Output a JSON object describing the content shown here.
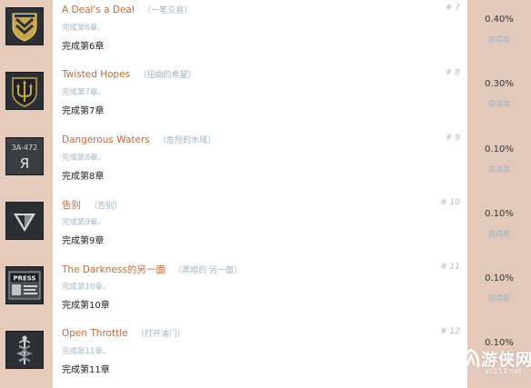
{
  "achievements": [
    {
      "title": "A Deal's a Deal",
      "subtitle": "（一笔交易）",
      "desc": "完成第6章。",
      "req": "完成第6章",
      "num": "# 7",
      "pct": "0.40%",
      "pct_label": "获得度",
      "icon": "chevron-shield-icon"
    },
    {
      "title": "Twisted Hopes",
      "subtitle": "（扭曲的希望）",
      "desc": "完成第7章。",
      "req": "完成第7章",
      "num": "# 8",
      "pct": "0.30%",
      "pct_label": "获得度",
      "icon": "trident-shield-icon"
    },
    {
      "title": "Dangerous Waters",
      "subtitle": "（危险的水域）",
      "desc": "完成第8章。",
      "req": "完成第8章",
      "num": "# 9",
      "pct": "0.10%",
      "pct_label": "获得度",
      "icon": "license-plate-icon",
      "icon_text": "3A-472",
      "icon_letter": "Я"
    },
    {
      "title": "告别",
      "subtitle": "（告别）",
      "desc": "完成第9章。",
      "req": "完成第9章",
      "num": "# 10",
      "pct": "0.10%",
      "pct_label": "获得度",
      "icon": "triangle-icon"
    },
    {
      "title": "The Darkness的另一面",
      "subtitle": "（黑暗的 另一面）",
      "desc": "完成第10章。",
      "req": "完成第10章",
      "num": "# 11",
      "pct": "0.10%",
      "pct_label": "获得度",
      "icon": "press-badge-icon",
      "icon_text": "PRESS"
    },
    {
      "title": "Open Throttle",
      "subtitle": "（打开油门）",
      "desc": "完成第11章。",
      "req": "完成第11章",
      "num": "# 12",
      "pct": "0.10%",
      "pct_label": "获得度",
      "icon": "caduceus-icon"
    }
  ],
  "watermark": {
    "text": "游侠网",
    "domain": "ali213.net"
  },
  "colors": {
    "title": "#c06a3c",
    "subtitle": "#9db3c4",
    "icon_bg": "#2c2f33",
    "side_bg": "#e3c9bb"
  }
}
